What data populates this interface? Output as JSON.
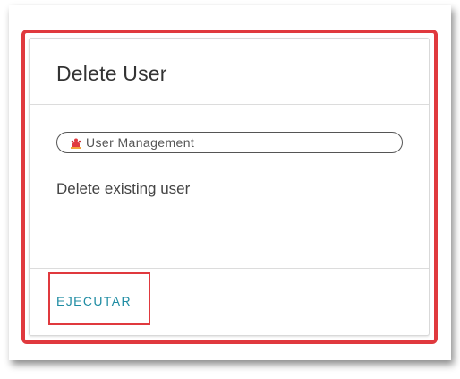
{
  "card": {
    "title": "Delete User",
    "tag_label": "User Management",
    "tag_icon": "user-group-icon",
    "description": "Delete existing user",
    "action_label": "EJECUTAR"
  },
  "colors": {
    "highlight": "#e0393e",
    "action": "#1f8ca3",
    "icon": "#e0393e"
  }
}
